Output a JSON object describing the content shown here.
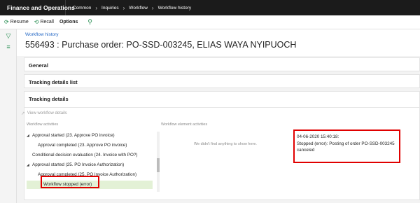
{
  "topbar": {
    "app_title": "Finance and Operations",
    "breadcrumbs": [
      "Common",
      "Inquiries",
      "Workflow",
      "Workflow history"
    ]
  },
  "actions": {
    "resume": "Resume",
    "recall": "Recall",
    "options": "Options"
  },
  "page": {
    "breadcrumb": "Workflow history",
    "title": "556493 : Purchase order: PO-SSD-003245, ELIAS WAYA NYIPUOCH"
  },
  "sections": {
    "general": "General",
    "tracking_list": "Tracking details list",
    "tracking_details": "Tracking details"
  },
  "tracking": {
    "view_details": "View workflow details",
    "activities_label": "Workflow activities",
    "element_label": "Workflow element activities",
    "empty_message": "We didn't find anything to show here.",
    "tree": [
      "Approval started (23. Approve PO invoice)",
      "Approval completed (23. Approve PO invoice)",
      "Conditional decision evaluation (24. Invoice with PO?)",
      "Approval started (25. PO Invoice Authorization)",
      "Approval completed (25. PO Invoice Authorization)",
      "Workflow stopped (error)"
    ],
    "detail": {
      "timestamp": "04-06-2020 15:40:18:",
      "message": "Stopped (error): Posting of order PO-SSD-003245 canceled"
    }
  },
  "highlight_color": "#e00000",
  "accent_color": "#1e8a4b",
  "icons": [
    "resume-icon",
    "recall-icon",
    "search-icon",
    "filter-icon",
    "menu-icon",
    "chevron-right-icon",
    "expand-arrow-icon"
  ]
}
